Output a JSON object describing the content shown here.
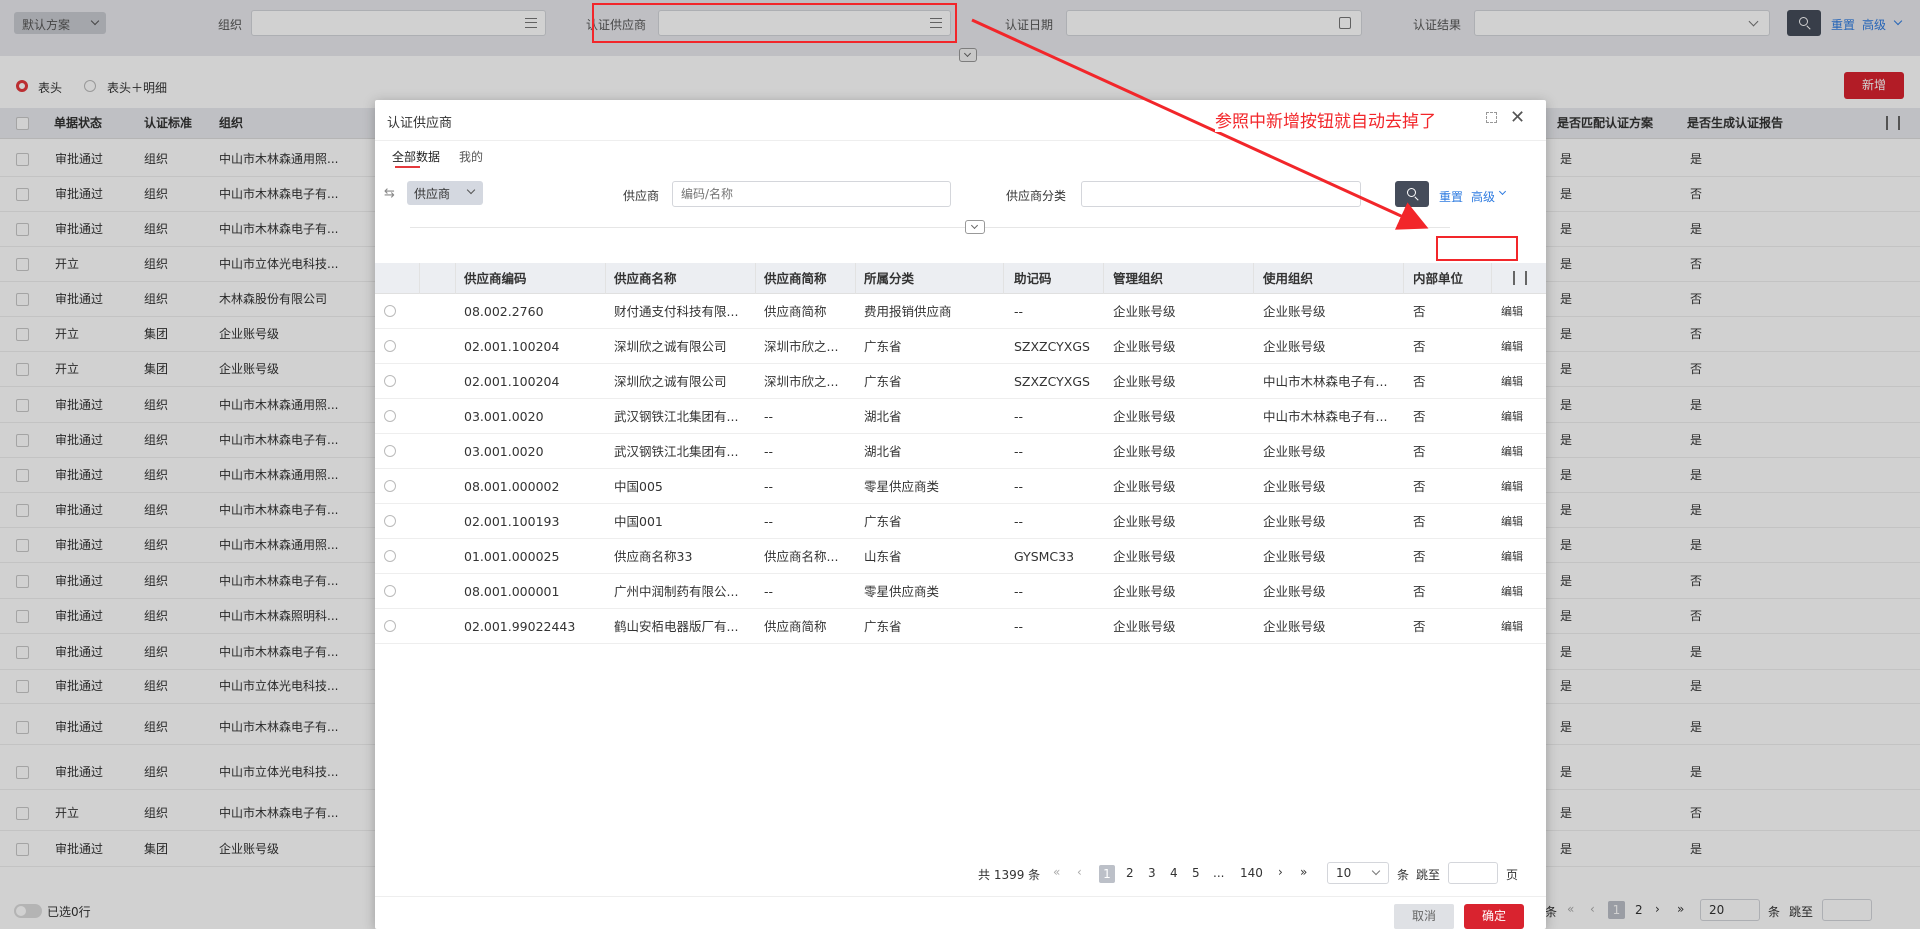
{
  "filter_bar": {
    "scheme": "默认方案",
    "org_label": "组织",
    "supplier_label": "认证供应商",
    "date_label": "认证日期",
    "result_label": "认证结果",
    "reset": "重置",
    "advanced": "高级"
  },
  "view": {
    "option1": "表头",
    "option2": "表头＋明细",
    "new_button": "新增"
  },
  "bg_table": {
    "headers": [
      "单据状态",
      "认证标准",
      "组织",
      "是否匹配认证方案",
      "是否生成认证报告"
    ],
    "rows": [
      {
        "status": "审批通过",
        "std": "组织",
        "org": "中山市木林森通用照...",
        "match": "是",
        "report": "是"
      },
      {
        "status": "审批通过",
        "std": "组织",
        "org": "中山市木林森电子有...",
        "match": "是",
        "report": "否"
      },
      {
        "status": "审批通过",
        "std": "组织",
        "org": "中山市木林森电子有...",
        "match": "是",
        "report": "是"
      },
      {
        "status": "开立",
        "std": "组织",
        "org": "中山市立体光电科技...",
        "match": "是",
        "report": "否"
      },
      {
        "status": "审批通过",
        "std": "组织",
        "org": "木林森股份有限公司",
        "match": "是",
        "report": "否"
      },
      {
        "status": "开立",
        "std": "集团",
        "org": "企业账号级",
        "match": "是",
        "report": "否"
      },
      {
        "status": "开立",
        "std": "集团",
        "org": "企业账号级",
        "match": "是",
        "report": "否"
      },
      {
        "status": "审批通过",
        "std": "组织",
        "org": "中山市木林森通用照...",
        "match": "是",
        "report": "是"
      },
      {
        "status": "审批通过",
        "std": "组织",
        "org": "中山市木林森电子有...",
        "match": "是",
        "report": "是"
      },
      {
        "status": "审批通过",
        "std": "组织",
        "org": "中山市木林森通用照...",
        "match": "是",
        "report": "是"
      },
      {
        "status": "审批通过",
        "std": "组织",
        "org": "中山市木林森电子有...",
        "match": "是",
        "report": "是"
      },
      {
        "status": "审批通过",
        "std": "组织",
        "org": "中山市木林森通用照...",
        "match": "是",
        "report": "是"
      },
      {
        "status": "审批通过",
        "std": "组织",
        "org": "中山市木林森电子有...",
        "match": "是",
        "report": "否"
      },
      {
        "status": "审批通过",
        "std": "组织",
        "org": "中山市木林森照明科...",
        "match": "是",
        "report": "否"
      },
      {
        "status": "审批通过",
        "std": "组织",
        "org": "中山市木林森电子有...",
        "match": "是",
        "report": "是"
      },
      {
        "status": "审批通过",
        "std": "组织",
        "org": "中山市立体光电科技...",
        "match": "是",
        "report": "是"
      },
      {
        "status": "审批通过",
        "std": "组织",
        "org": "中山市木林森电子有...",
        "match": "是",
        "report": "是"
      },
      {
        "status": "审批通过",
        "std": "组织",
        "org": "中山市立体光电科技...",
        "match": "是",
        "report": "是"
      },
      {
        "status": "开立",
        "std": "组织",
        "org": "中山市木林森电子有...",
        "match": "是",
        "report": "否"
      },
      {
        "status": "审批通过",
        "std": "集团",
        "org": "企业账号级",
        "match": "是",
        "report": "是"
      }
    ],
    "selected": "已选0行",
    "pager": {
      "jump": "跳至",
      "size": "20",
      "p1": "1",
      "p2": "2",
      "unit": "条"
    }
  },
  "modal": {
    "title": "认证供应商",
    "tab_all": "全部数据",
    "tab_mine": "我的",
    "type_select": "供应商",
    "supplier_label": "供应商",
    "supplier_placeholder": "编码/名称",
    "category_label": "供应商分类",
    "reset": "重置",
    "advanced": "高级",
    "headers": [
      "供应商编码",
      "供应商名称",
      "供应商简称",
      "所属分类",
      "助记码",
      "管理组织",
      "使用组织",
      "内部单位"
    ],
    "rows": [
      {
        "code": "08.002.2760",
        "name": "财付通支付科技有限...",
        "short": "供应商简称",
        "cat": "费用报销供应商",
        "mnem": "--",
        "mgr": "企业账号级",
        "use": "企业账号级",
        "inner": "否",
        "op": "编辑"
      },
      {
        "code": "02.001.100204",
        "name": "深圳欣之诚有限公司",
        "short": "深圳市欣之...",
        "cat": "广东省",
        "mnem": "SZXZCYXGS",
        "mgr": "企业账号级",
        "use": "企业账号级",
        "inner": "否",
        "op": "编辑"
      },
      {
        "code": "02.001.100204",
        "name": "深圳欣之诚有限公司",
        "short": "深圳市欣之...",
        "cat": "广东省",
        "mnem": "SZXZCYXGS",
        "mgr": "企业账号级",
        "use": "中山市木林森电子有...",
        "inner": "否",
        "op": "编辑"
      },
      {
        "code": "03.001.0020",
        "name": "武汉钢铁江北集团有...",
        "short": "--",
        "cat": "湖北省",
        "mnem": "--",
        "mgr": "企业账号级",
        "use": "中山市木林森电子有...",
        "inner": "否",
        "op": "编辑"
      },
      {
        "code": "03.001.0020",
        "name": "武汉钢铁江北集团有...",
        "short": "--",
        "cat": "湖北省",
        "mnem": "--",
        "mgr": "企业账号级",
        "use": "企业账号级",
        "inner": "否",
        "op": "编辑"
      },
      {
        "code": "08.001.000002",
        "name": "中国005",
        "short": "--",
        "cat": "零星供应商类",
        "mnem": "--",
        "mgr": "企业账号级",
        "use": "企业账号级",
        "inner": "否",
        "op": "编辑"
      },
      {
        "code": "02.001.100193",
        "name": "中国001",
        "short": "--",
        "cat": "广东省",
        "mnem": "--",
        "mgr": "企业账号级",
        "use": "企业账号级",
        "inner": "否",
        "op": "编辑"
      },
      {
        "code": "01.001.000025",
        "name": "供应商名称33",
        "short": "供应商名称...",
        "cat": "山东省",
        "mnem": "GYSMC33",
        "mgr": "企业账号级",
        "use": "企业账号级",
        "inner": "否",
        "op": "编辑"
      },
      {
        "code": "08.001.000001",
        "name": "广州中润制药有限公...",
        "short": "--",
        "cat": "零星供应商类",
        "mnem": "--",
        "mgr": "企业账号级",
        "use": "企业账号级",
        "inner": "否",
        "op": "编辑"
      },
      {
        "code": "02.001.99022443",
        "name": "鹤山安栢电器版厂有...",
        "short": "供应商简称",
        "cat": "广东省",
        "mnem": "--",
        "mgr": "企业账号级",
        "use": "企业账号级",
        "inner": "否",
        "op": "编辑"
      }
    ],
    "pager": {
      "total": "共 1399 条",
      "pages": [
        "1",
        "2",
        "3",
        "4",
        "5",
        "...",
        "140"
      ],
      "size": "10",
      "unit": "条",
      "jump": "跳至",
      "page_unit": "页"
    },
    "cancel": "取消",
    "confirm": "确定"
  },
  "annotation": {
    "text": "参照中新增按钮就自动去掉了",
    "color": "#f2262a"
  }
}
